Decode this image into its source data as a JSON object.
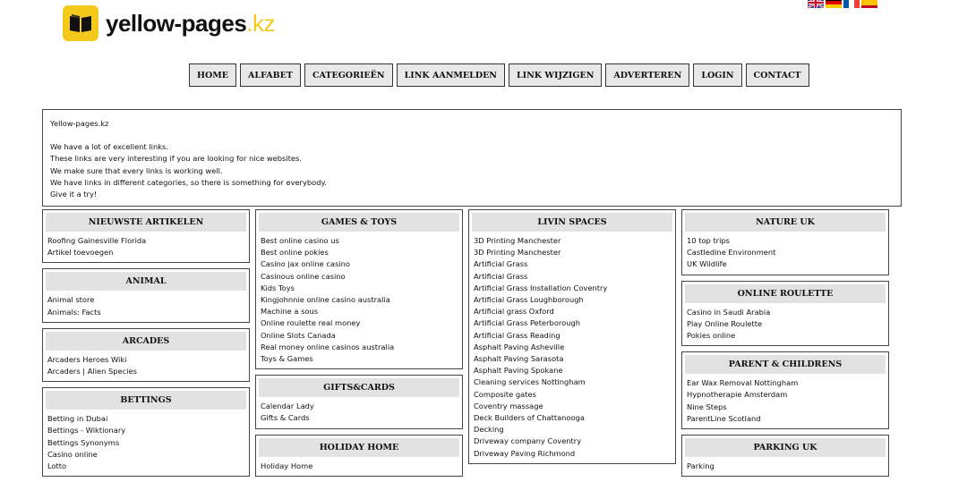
{
  "site": {
    "name": "yellow-pages",
    "tld": ".kz"
  },
  "languages": [
    "English",
    "Deutsch",
    "Français",
    "Español"
  ],
  "nav": [
    "HOME",
    "ALFABET",
    "CATEGORIEËN",
    "LINK AANMELDEN",
    "LINK WIJZIGEN",
    "ADVERTEREN",
    "LOGIN",
    "CONTACT"
  ],
  "intro": {
    "title": "Yellow-pages.kz",
    "lines": [
      "We have a lot of excellent links.",
      "These links are very interesting if you are looking for nice websites.",
      "We make sure that every links is working well.",
      "We have links in different categories, so there is something for everybody.",
      "Give it a try!"
    ]
  },
  "columns": [
    [
      {
        "title": "NIEUWSTE ARTIKELEN",
        "links": [
          "Roofing Gainesville Florida",
          "Artikel toevoegen"
        ]
      },
      {
        "title": "ANIMAL",
        "links": [
          "Animal store",
          "Animals: Facts"
        ]
      },
      {
        "title": "ARCADES",
        "links": [
          "Arcaders Heroes Wiki",
          "Arcaders | Alien Species"
        ]
      },
      {
        "title": "BETTINGS",
        "links": [
          "Betting in Dubai",
          "Bettings - Wiktionary",
          "Bettings Synonyms",
          "Casino online",
          "Lotto"
        ]
      }
    ],
    [
      {
        "title": "GAMES & TOYS",
        "links": [
          "Best online casino us",
          "Best online pokies",
          "Casino jax online casino",
          "Casinous online casino",
          "Kids Toys",
          "Kingjohnnie online casino australia",
          "Machine a sous",
          "Online roulette real money",
          "Online Slots Canada",
          "Real money online casinos australia",
          "Toys & Games"
        ]
      },
      {
        "title": "GIFTS&CARDS",
        "links": [
          "Calendar Lady",
          "Gifts & Cards"
        ]
      },
      {
        "title": "HOLIDAY HOME",
        "links": [
          "Holiday Home"
        ]
      }
    ],
    [
      {
        "title": "LIVIN SPACES",
        "links": [
          "3D Printing Manchester",
          "3D Printing Manchester",
          "Artificial Grass",
          "Artificial Grass",
          "Artificial Grass Installation Coventry",
          "Artificial Grass Loughborough",
          "Artificial grass Oxford",
          "Artificial Grass Peterborough",
          "Artificial Grass Reading",
          "Asphalt Paving Asheville",
          "Asphalt Paving Sarasota",
          "Asphalt Paving Spokane",
          "Cleaning services Nottingham",
          "Composite gates",
          "Coventry massage",
          "Deck Builders of Chattanooga",
          "Decking",
          "Driveway company Coventry",
          "Driveway Paving Richmond"
        ]
      }
    ],
    [
      {
        "title": "NATURE UK",
        "links": [
          "10 top trips",
          "Castledine Environment",
          "UK Wildlife"
        ]
      },
      {
        "title": "ONLINE ROULETTE",
        "links": [
          "Casino in Saudi Arabia",
          "Play Online Roulette",
          "Pokies online"
        ]
      },
      {
        "title": "PARENT & CHILDRENS",
        "links": [
          "Ear Wax Removal Nottingham",
          "Hypnotherapie Amsterdam",
          "Nine Steps",
          "ParentLine Scotland"
        ]
      },
      {
        "title": "PARKING UK",
        "links": [
          "Parking"
        ]
      }
    ]
  ]
}
